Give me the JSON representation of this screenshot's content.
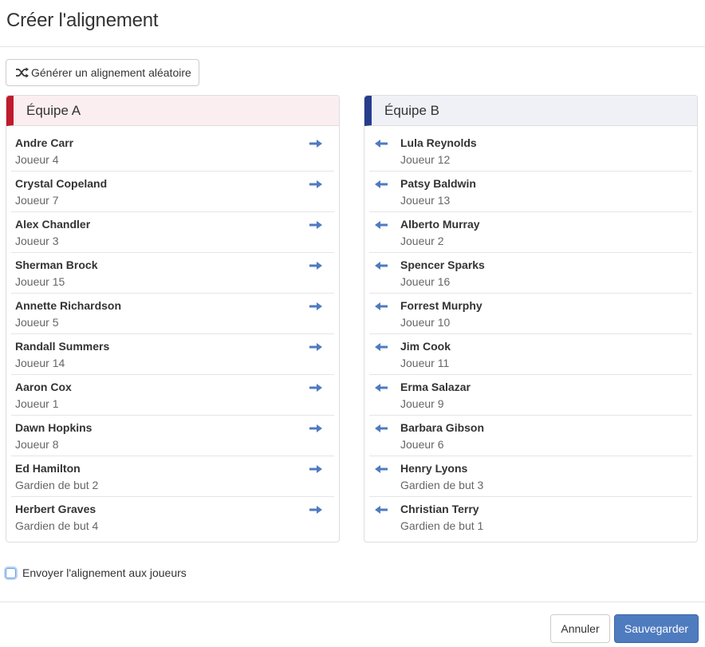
{
  "dialog": {
    "title": "Créer l'alignement"
  },
  "random_button": {
    "label": "Générer un alignement aléatoire",
    "icon": "shuffle-icon"
  },
  "team_a": {
    "name": "Équipe A",
    "accent": "#c01a2c",
    "players": [
      {
        "name": "Andre Carr",
        "role": "Joueur 4"
      },
      {
        "name": "Crystal Copeland",
        "role": "Joueur 7"
      },
      {
        "name": "Alex Chandler",
        "role": "Joueur 3"
      },
      {
        "name": "Sherman Brock",
        "role": "Joueur 15"
      },
      {
        "name": "Annette Richardson",
        "role": "Joueur 5"
      },
      {
        "name": "Randall Summers",
        "role": "Joueur 14"
      },
      {
        "name": "Aaron Cox",
        "role": "Joueur 1"
      },
      {
        "name": "Dawn Hopkins",
        "role": "Joueur 8"
      },
      {
        "name": "Ed Hamilton",
        "role": "Gardien de but 2"
      },
      {
        "name": "Herbert Graves",
        "role": "Gardien de but 4"
      }
    ]
  },
  "team_b": {
    "name": "Équipe B",
    "accent": "#263d8c",
    "players": [
      {
        "name": "Lula Reynolds",
        "role": "Joueur 12"
      },
      {
        "name": "Patsy Baldwin",
        "role": "Joueur 13"
      },
      {
        "name": "Alberto Murray",
        "role": "Joueur 2"
      },
      {
        "name": "Spencer Sparks",
        "role": "Joueur 16"
      },
      {
        "name": "Forrest Murphy",
        "role": "Joueur 10"
      },
      {
        "name": "Jim Cook",
        "role": "Joueur 11"
      },
      {
        "name": "Erma Salazar",
        "role": "Joueur 9"
      },
      {
        "name": "Barbara Gibson",
        "role": "Joueur 6"
      },
      {
        "name": "Henry Lyons",
        "role": "Gardien de but 3"
      },
      {
        "name": "Christian Terry",
        "role": "Gardien de but 1"
      }
    ]
  },
  "send_option": {
    "label": "Envoyer l'alignement aux joueurs",
    "checked": false
  },
  "footer": {
    "cancel_label": "Annuler",
    "save_label": "Sauvegarder"
  },
  "colors": {
    "arrow": "#4f7bbf",
    "primary": "#4f7bbf"
  }
}
